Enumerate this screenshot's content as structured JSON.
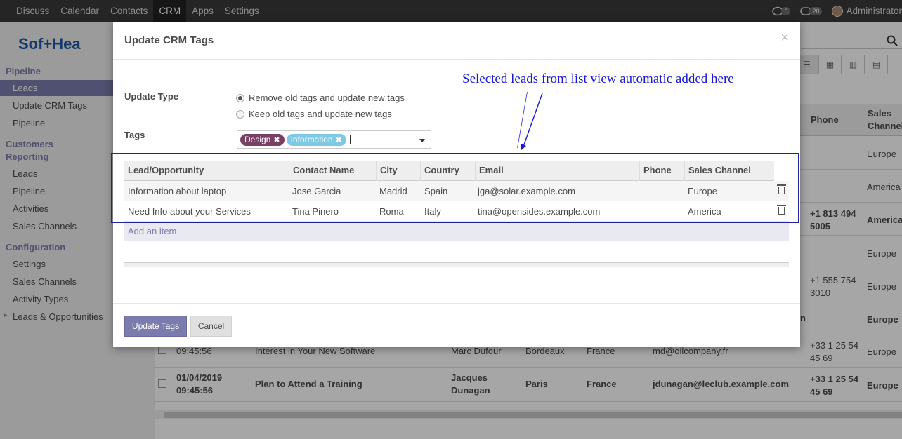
{
  "topbar": {
    "menu": [
      "Discuss",
      "Calendar",
      "Contacts",
      "CRM",
      "Apps",
      "Settings"
    ],
    "active": "CRM",
    "chat_count": "6",
    "activity_count": "20",
    "user": "Administrator"
  },
  "logo": "Sof+Hea",
  "sidebar": {
    "pipeline_head": "Pipeline",
    "leads": "Leads",
    "update_crm_tags": "Update CRM Tags",
    "pipeline": "Pipeline",
    "reporting_head_1": "Customers",
    "reporting_head_2": "Reporting",
    "r_leads": "Leads",
    "r_pipeline": "Pipeline",
    "r_activities": "Activities",
    "r_sales_channels": "Sales Channels",
    "config_head": "Configuration",
    "c_settings": "Settings",
    "c_sales_channels": "Sales Channels",
    "c_activity_types": "Activity Types",
    "c_leads_opps": "Leads & Opportunities"
  },
  "bg_table": {
    "phone_head": "Phone",
    "sales_head_1": "Sales",
    "sales_head_2": "Channel",
    "col_phone": [
      {
        "l1": "",
        "l2": ""
      },
      {
        "l1": "",
        "l2": ""
      },
      {
        "l1": "+1 813 494",
        "l2": "5005"
      },
      {
        "l1": "",
        "l2": ""
      },
      {
        "l1": "+1 555 754",
        "l2": "3010"
      },
      {
        "l1": "",
        "l2": ""
      },
      {
        "l1": "+33 1 25 54",
        "l2": "45 69"
      },
      {
        "l1": "+33 1 25 54",
        "l2": "45 69"
      }
    ],
    "col_sales": [
      "Europe",
      "America",
      "America",
      "Europe",
      "Europe",
      "Europe",
      "Europe",
      "Europe"
    ],
    "row7": {
      "date": "09:45:56",
      "name": "Interest in Your New Software",
      "contact": "Marc Dufour",
      "city": "Bordeaux",
      "country": "France",
      "email": "md@oilcompany.fr"
    },
    "row8": {
      "date_1": "01/04/2019",
      "date_2": "09:45:56",
      "name": "Plan to Attend a Training",
      "contact_1": "Jacques",
      "contact_2": "Dunagan",
      "city": "Paris",
      "country": "France",
      "email": "jdunagan@leclub.example.com"
    },
    "partial_n": "n"
  },
  "modal": {
    "title": "Update CRM Tags",
    "close": "×",
    "update_type_label": "Update Type",
    "radio_1": "Remove old tags and update new tags",
    "radio_2": "Keep old tags and update new tags",
    "tags_label": "Tags",
    "tags": [
      {
        "name": "Design",
        "color": "#7b3e66"
      },
      {
        "name": "Information",
        "color": "#7ec9e3"
      }
    ],
    "annotation": "Selected leads from list view automatic added here",
    "columns": [
      "Lead/Opportunity",
      "Contact Name",
      "City",
      "Country",
      "Email",
      "Phone",
      "Sales Channel"
    ],
    "rows": [
      {
        "lead": "Information about laptop",
        "contact": "Jose Garcia",
        "city": "Madrid",
        "country": "Spain",
        "email": "jga@solar.example.com",
        "phone": "",
        "channel": "Europe"
      },
      {
        "lead": "Need Info about your Services",
        "contact": "Tina Pinero",
        "city": "Roma",
        "country": "Italy",
        "email": "tina@opensides.example.com",
        "phone": "",
        "channel": "America"
      }
    ],
    "add_item": "Add an item",
    "update_btn": "Update Tags",
    "cancel_btn": "Cancel"
  },
  "colors": {
    "accent": "#7c7bad",
    "highlight": "#2121a8",
    "annotation": "#1a1ad6"
  }
}
